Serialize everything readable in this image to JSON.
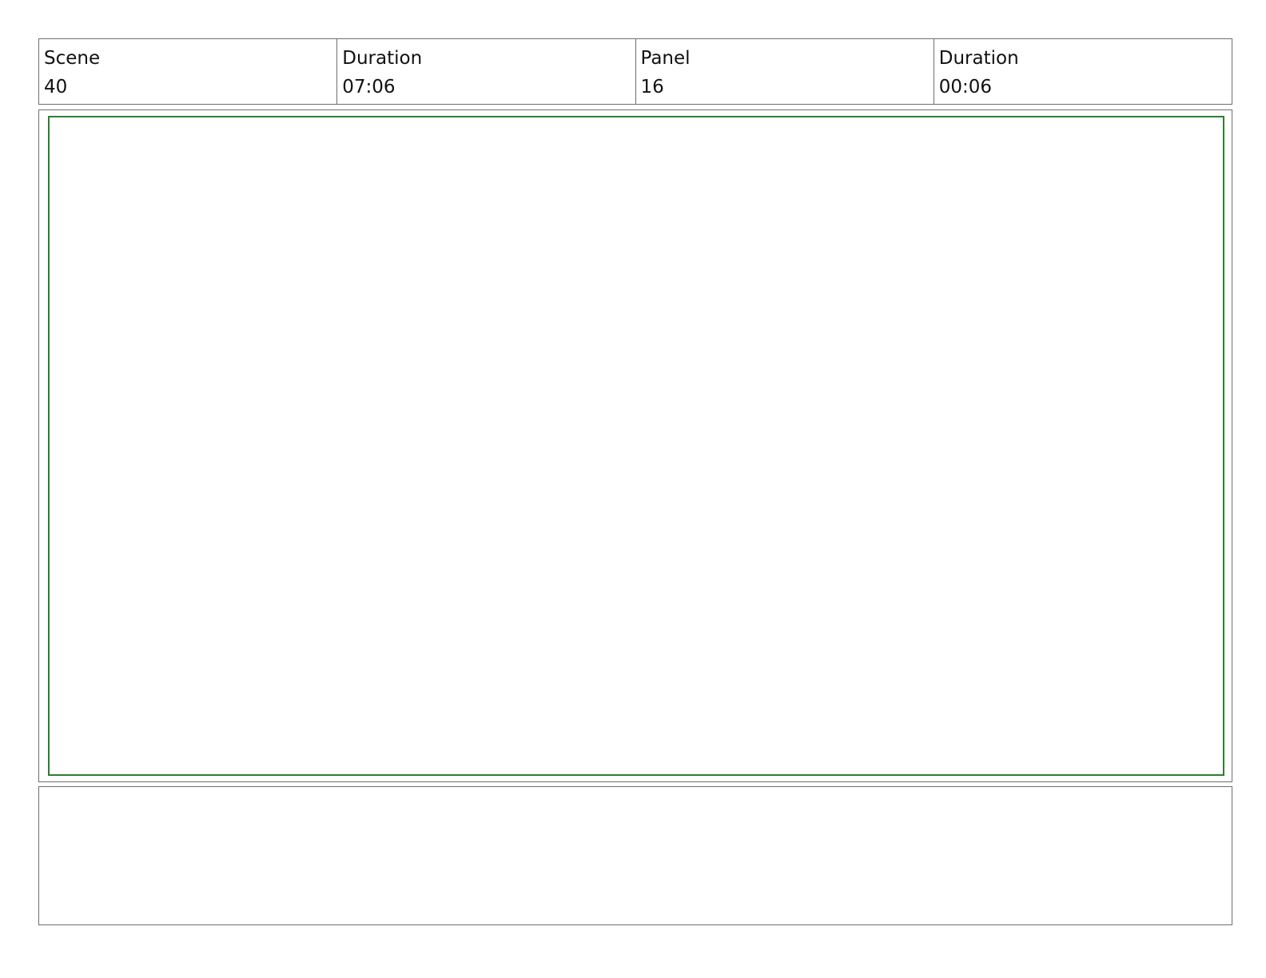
{
  "header": {
    "scene": {
      "label": "Scene",
      "value": "40"
    },
    "scene_duration": {
      "label": "Duration",
      "value": "07:06"
    },
    "panel": {
      "label": "Panel",
      "value": "16"
    },
    "panel_duration": {
      "label": "Duration",
      "value": "00:06"
    }
  },
  "colors": {
    "border": "#6f6f6f",
    "image_frame": "#2f7d32",
    "background": "#ffffff",
    "text": "#111111"
  },
  "notes": {
    "text": ""
  }
}
